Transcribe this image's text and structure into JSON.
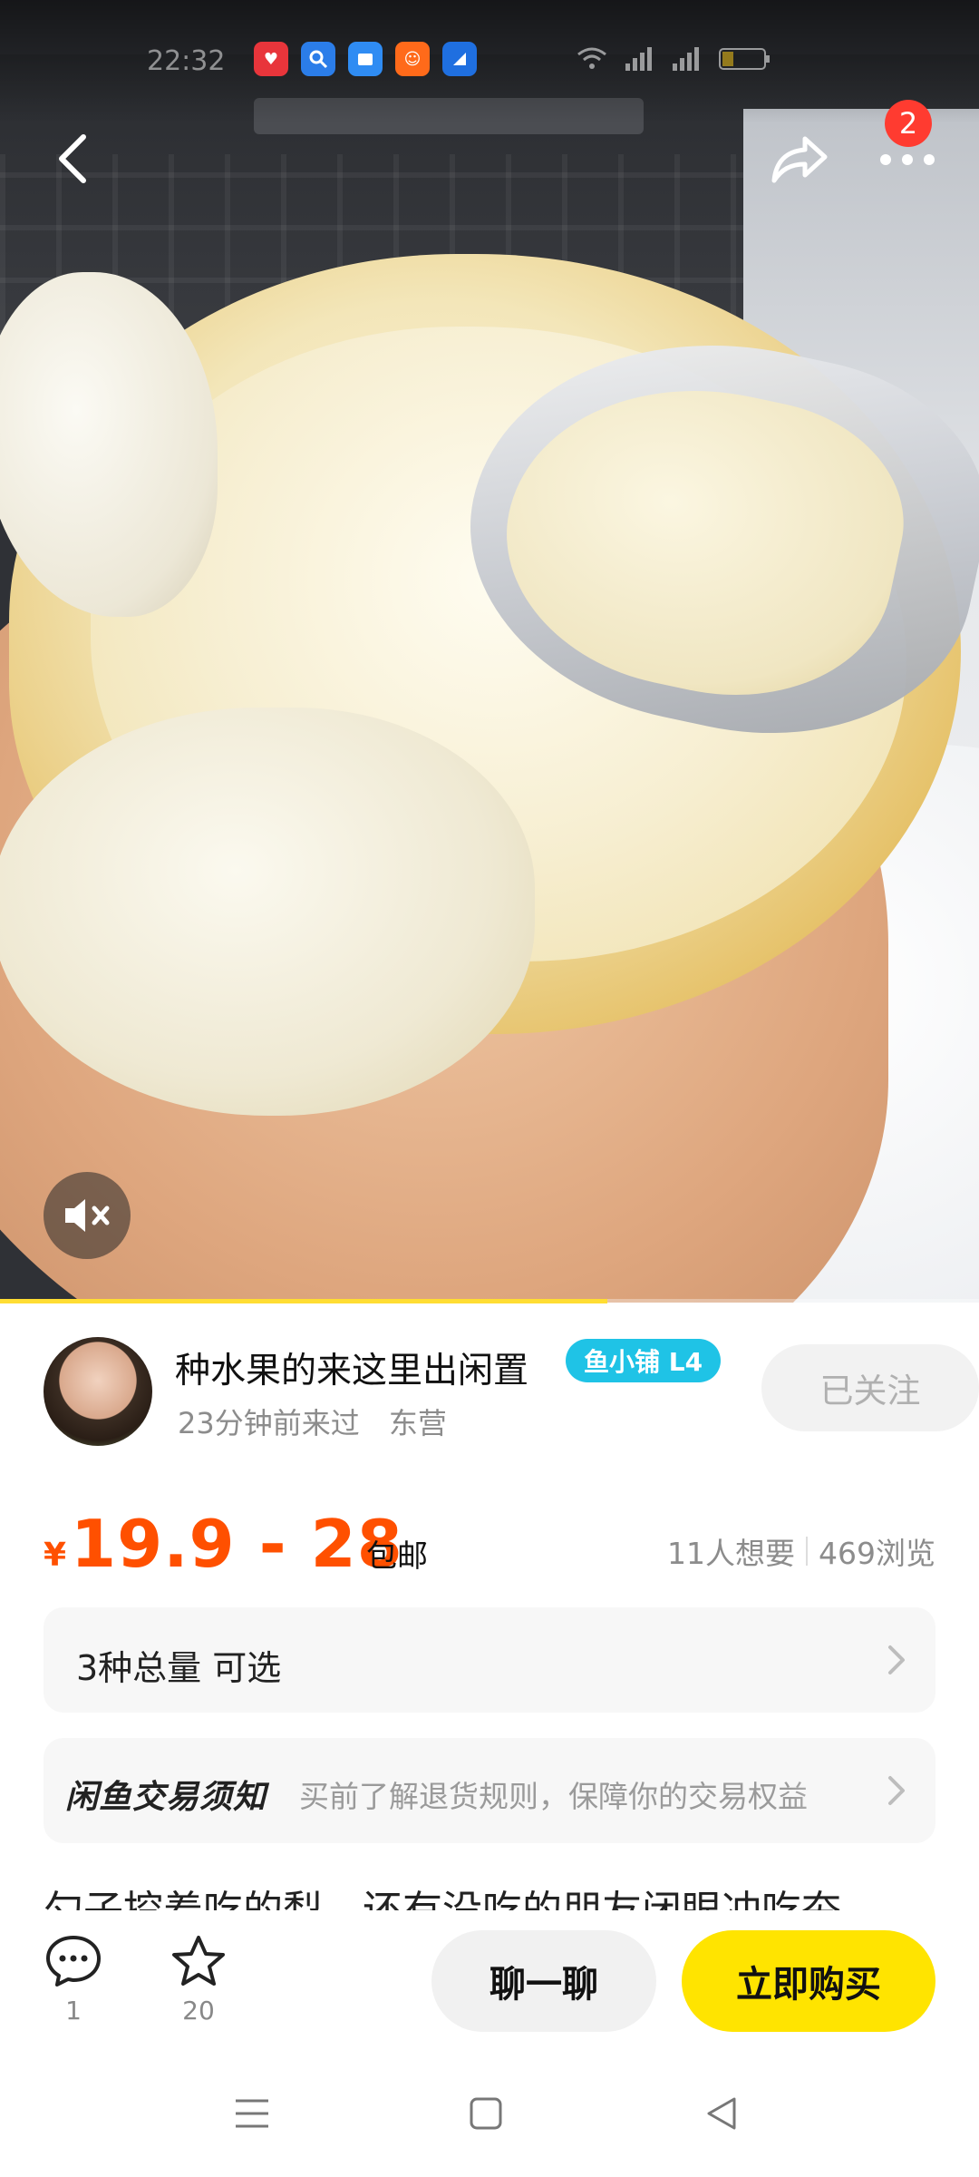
{
  "status_bar": {
    "time": "22:32",
    "app_icons": [
      {
        "name": "app-red-icon",
        "glyph": "",
        "color": "#e8353b"
      },
      {
        "name": "app-search-icon",
        "glyph": "",
        "color": "#2b7de9"
      },
      {
        "name": "app-files-icon",
        "glyph": "",
        "color": "#2f8cf3"
      },
      {
        "name": "app-taobao-icon",
        "glyph": "",
        "color": "#ff6a1a"
      },
      {
        "name": "app-blue-icon",
        "glyph": "",
        "color": "#1f6fe0"
      }
    ]
  },
  "topbar": {
    "more_badge": "2"
  },
  "video": {
    "progress": 0.62
  },
  "seller": {
    "name": "种水果的来这里出闲置",
    "badge": "鱼小铺 L4",
    "last_seen": "23分钟前来过",
    "location": "东营",
    "follow_label": "已关注"
  },
  "price": {
    "currency": "¥",
    "range": "19.9 - 28",
    "shipping": "包邮",
    "wants": "11人想要",
    "views": "469浏览"
  },
  "variant": {
    "label": "3种总量 可选"
  },
  "notice": {
    "title": "闲鱼交易须知",
    "desc": "买前了解退货规则，保障你的交易权益"
  },
  "description": {
    "preview": "勺子挖着吃的梨，还有没吃的朋友闭眼冲吃夯"
  },
  "actions": {
    "comments_count": "1",
    "favorites_count": "20",
    "chat_label": "聊一聊",
    "buy_label": "立即购买"
  },
  "colors": {
    "accent_price": "#ff5000",
    "buy_button": "#ffe400",
    "badge": "#1fc3e6",
    "notification": "#ff3b30"
  }
}
